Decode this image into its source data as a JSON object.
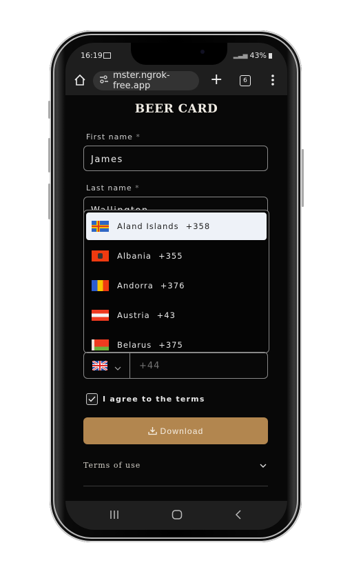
{
  "status_bar": {
    "time": "16:19",
    "battery": "43%"
  },
  "browser": {
    "url": "mster.ngrok-free.app",
    "tab_count": "6"
  },
  "page": {
    "title": "BEER CARD",
    "first_name": {
      "label": "First name",
      "required_mark": "*",
      "value": "James"
    },
    "last_name": {
      "label": "Last name",
      "required_mark": "*",
      "value": "Wallington"
    },
    "country_dropdown": {
      "options": [
        {
          "name": "Aland Islands",
          "code": "+358",
          "selected": true
        },
        {
          "name": "Albania",
          "code": "+355"
        },
        {
          "name": "Andorra",
          "code": "+376"
        },
        {
          "name": "Austria",
          "code": "+43"
        },
        {
          "name": "Belarus",
          "code": "+375"
        }
      ]
    },
    "phone": {
      "country": "United Kingdom",
      "placeholder": "+44"
    },
    "agree_label": "I agree to the terms",
    "agree_checked": true,
    "download_label": "Download",
    "accent_color": "#b2864f",
    "terms_label": "Terms of use"
  }
}
